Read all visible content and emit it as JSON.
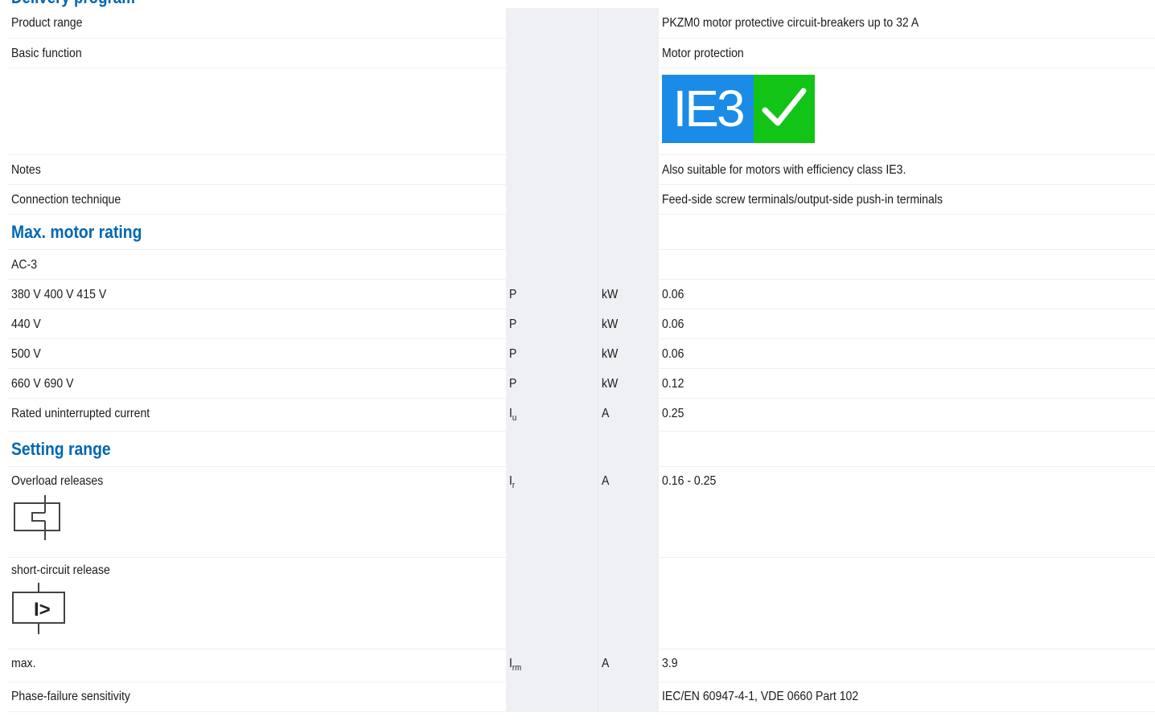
{
  "header": {
    "cut_title": "Delivery program"
  },
  "rows": {
    "product_range": {
      "label": "Product range",
      "value": "PKZM0 motor protective circuit-breakers up to 32 A"
    },
    "basic_function": {
      "label": "Basic function",
      "value": "Motor protection"
    },
    "ie3_logo": {
      "text": "IE3",
      "colors": {
        "blue": "#1a8ce8",
        "green": "#12c416"
      },
      "icon": "checkmark-icon"
    },
    "notes": {
      "label": "Notes",
      "value": "Also suitable for motors with efficiency class IE3."
    },
    "connection": {
      "label": "Connection technique",
      "value": "Feed-side screw terminals/output-side push-in terminals"
    },
    "max_motor_rating": {
      "title": "Max. motor rating"
    },
    "ac3": {
      "label": "AC-3"
    },
    "v380": {
      "label": "380 V 400 V 415 V",
      "symbol": "P",
      "unit": "kW",
      "value": "0.06"
    },
    "v440": {
      "label": "440 V",
      "symbol": "P",
      "unit": "kW",
      "value": "0.06"
    },
    "v500": {
      "label": "500 V",
      "symbol": "P",
      "unit": "kW",
      "value": "0.06"
    },
    "v660": {
      "label": "660 V 690 V",
      "symbol": "P",
      "unit": "kW",
      "value": "0.12"
    },
    "rated_current": {
      "label": "Rated uninterrupted current",
      "symbol": "I",
      "symbol_sub": "u",
      "unit": "A",
      "value": "0.25"
    },
    "setting_range": {
      "title": "Setting range"
    },
    "overload": {
      "label": "Overload releases",
      "symbol": "I",
      "symbol_sub": "r",
      "unit": "A",
      "value": "0.16 - 0.25",
      "icon": "thermal-release-icon"
    },
    "short_circuit": {
      "label": "short-circuit release",
      "icon": "magnetic-release-icon",
      "icon_text": "I>"
    },
    "max": {
      "label": "max.",
      "symbol": "I",
      "symbol_sub": "rm",
      "unit": "A",
      "value": "3.9"
    },
    "phase_failure": {
      "label": "Phase-failure sensitivity",
      "value": "IEC/EN 60947-4-1, VDE 0660 Part 102"
    }
  },
  "colors": {
    "accent": "#0066b3",
    "shade": "#eef0f4"
  }
}
